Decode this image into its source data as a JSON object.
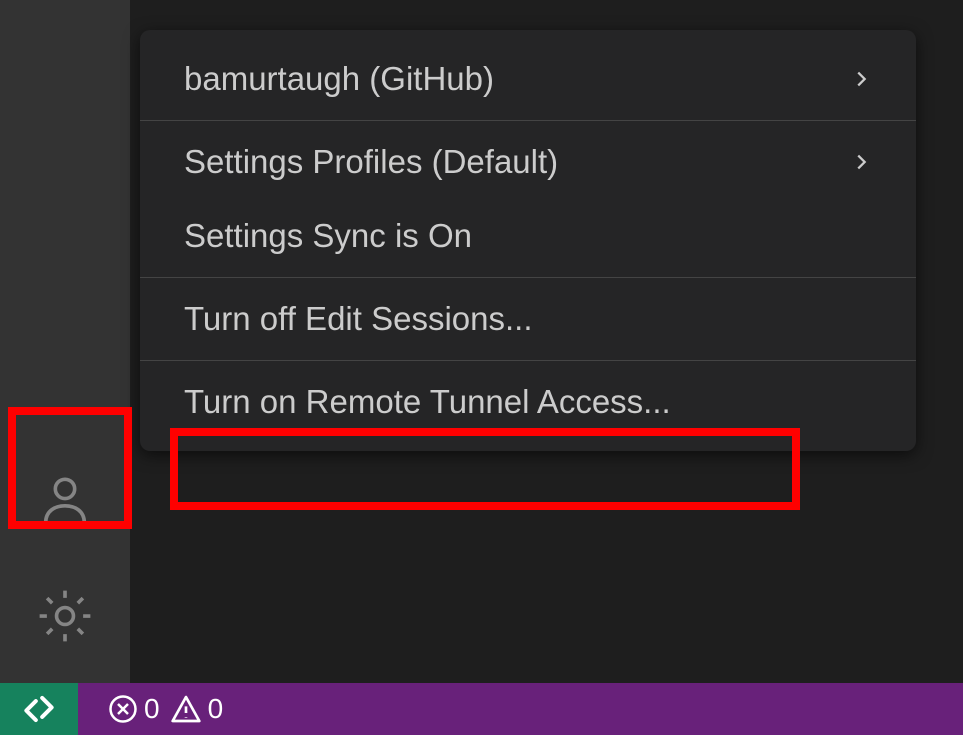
{
  "menu": {
    "account_label": "bamurtaugh (GitHub)",
    "profiles_label": "Settings Profiles (Default)",
    "sync_label": "Settings Sync is On",
    "edit_sessions_label": "Turn off Edit Sessions...",
    "remote_tunnel_label": "Turn on Remote Tunnel Access..."
  },
  "status_bar": {
    "errors_count": "0",
    "warnings_count": "0"
  }
}
